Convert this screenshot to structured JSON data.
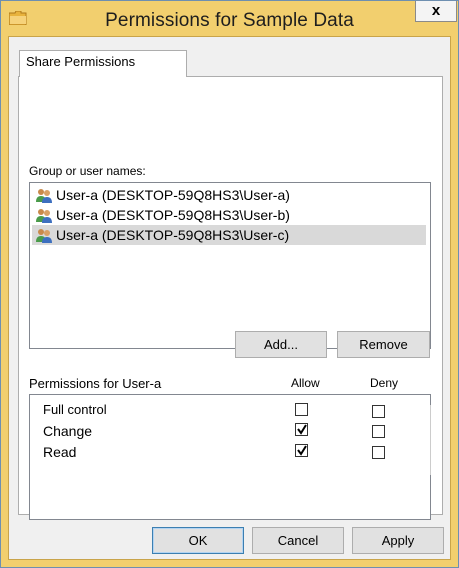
{
  "window": {
    "title": "Permissions for Sample Data",
    "close_label": "x"
  },
  "tabs": [
    {
      "label": "Share Permissions"
    }
  ],
  "group": {
    "label": "Group or user names:",
    "users": [
      {
        "name": "User-a (DESKTOP-59Q8HS3\\User-a)",
        "selected": false
      },
      {
        "name": "User-a (DESKTOP-59Q8HS3\\User-b)",
        "selected": false
      },
      {
        "name": "User-a (DESKTOP-59Q8HS3\\User-c)",
        "selected": true
      }
    ],
    "add_label": "Add...",
    "remove_label": "Remove"
  },
  "permissions": {
    "label": "Permissions for User-a",
    "allow_header": "Allow",
    "deny_header": "Deny",
    "rows": [
      {
        "name": "Full control",
        "allow": false,
        "deny": false
      },
      {
        "name": "Change",
        "allow": true,
        "deny": false
      },
      {
        "name": "Read",
        "allow": true,
        "deny": false
      }
    ]
  },
  "footer": {
    "ok_label": "OK",
    "cancel_label": "Cancel",
    "apply_label": "Apply"
  },
  "colors": {
    "frame": "#f2cf6e",
    "selection": "#d9d9d9",
    "default_button_border": "#3c7fb1"
  }
}
